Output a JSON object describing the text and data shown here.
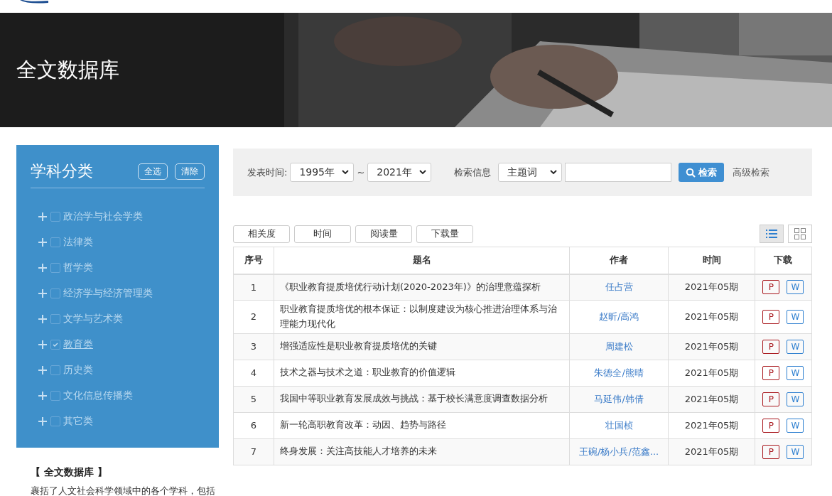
{
  "banner": {
    "title": "全文数据库",
    "kind": "picture"
  },
  "sidebar": {
    "title": "学科分类",
    "buttons": [
      "全选",
      "清除"
    ],
    "items": [
      {
        "label": "政治学与社会学类",
        "checked": false
      },
      {
        "label": "法律类",
        "checked": false
      },
      {
        "label": "哲学类",
        "checked": false
      },
      {
        "label": "经济学与经济管理类",
        "checked": false
      },
      {
        "label": "文学与艺术类",
        "checked": false
      },
      {
        "label": "教育类",
        "checked": true
      },
      {
        "label": "历史类",
        "checked": false
      },
      {
        "label": "文化信息传播类",
        "checked": false
      },
      {
        "label": "其它类",
        "checked": false
      }
    ],
    "about_title": "【 全文数据库 】",
    "about_text": "裹括了人文社会科学领域中的各个学科，包括"
  },
  "search": {
    "date_label": "发表时间:",
    "from": "1995年",
    "separator": "~",
    "to": "2021年",
    "field_label": "检索信息",
    "field": "主题词",
    "button": "检索",
    "advanced": "高级检索"
  },
  "sort_buttons": [
    "相关度",
    "时间",
    "阅读量",
    "下载量"
  ],
  "view_toggle": [
    {
      "kind": "list",
      "selected": true
    },
    {
      "kind": "grid",
      "selected": false
    }
  ],
  "table": {
    "columns": [
      "序号",
      "题名",
      "作者",
      "时间",
      "下载"
    ],
    "rows": [
      {
        "no": "1",
        "title": "《职业教育提质培优行动计划(2020-2023年)》的治理意蕴探析",
        "author": "任占营",
        "time": "2021年05期",
        "pdf": "P",
        "word": "W"
      },
      {
        "no": "2",
        "title": "职业教育提质培优的根本保证：以制度建设为核心推进治理体系与治理能力现代化",
        "author": "赵昕/高鸿",
        "time": "2021年05期",
        "pdf": "P",
        "word": "W"
      },
      {
        "no": "3",
        "title": "增强适应性是职业教育提质培优的关键",
        "author": "周建松",
        "time": "2021年05期",
        "pdf": "P",
        "word": "W"
      },
      {
        "no": "4",
        "title": "技术之器与技术之道：职业教育的价值逻辑",
        "author": "朱德全/熊晴",
        "time": "2021年05期",
        "pdf": "P",
        "word": "W"
      },
      {
        "no": "5",
        "title": "我国中等职业教育发展成效与挑战：基于校长满意度调查数据分析",
        "author": "马延伟/韩倩",
        "time": "2021年05期",
        "pdf": "P",
        "word": "W"
      },
      {
        "no": "6",
        "title": "新一轮高职教育改革：动因、趋势与路径",
        "author": "壮国桢",
        "time": "2021年05期",
        "pdf": "P",
        "word": "W"
      },
      {
        "no": "7",
        "title": "终身发展：关注高技能人才培养的未来",
        "author": "王碗/杨小兵/范鑫...",
        "time": "2021年05期",
        "pdf": "P",
        "word": "W"
      }
    ]
  }
}
